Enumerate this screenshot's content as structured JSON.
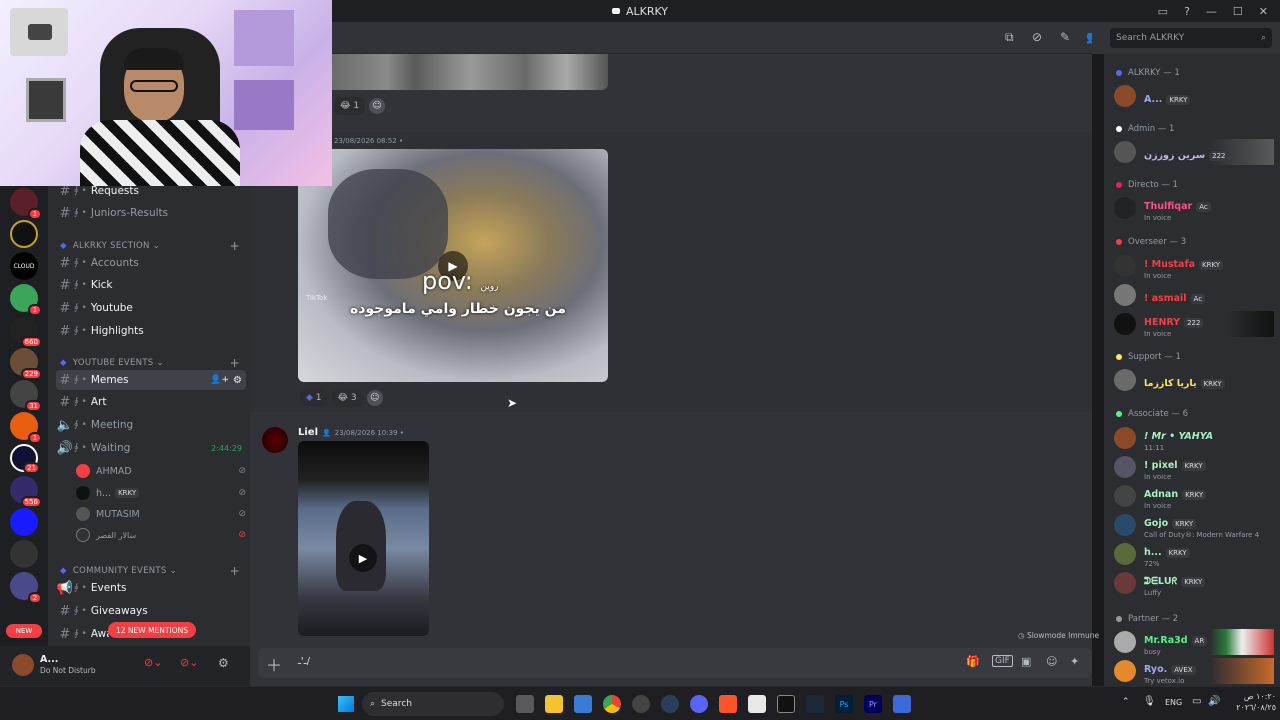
{
  "window": {
    "title": "ALKRKY"
  },
  "header": {
    "search_placeholder": "Search ALKRKY"
  },
  "channels": {
    "items_top": [
      {
        "label": "Requests"
      },
      {
        "label": "Juniors-Results"
      }
    ],
    "cat_alkrky": "ALKRKY SECTION",
    "alkrky_items": [
      {
        "label": "Accounts"
      },
      {
        "label": "Kick"
      },
      {
        "label": "Youtube"
      },
      {
        "label": "Highlights"
      }
    ],
    "cat_youtube": "YOUTUBE EVENTS",
    "youtube_items": [
      {
        "label": "Memes"
      },
      {
        "label": "Art"
      },
      {
        "label": "Meeting"
      },
      {
        "label": "Waiting",
        "timer": "2:44:29"
      }
    ],
    "voice_users": [
      {
        "name": "AHMAD"
      },
      {
        "name": "h...",
        "tag": "KRKY"
      },
      {
        "name": "MUTASIM"
      },
      {
        "name": "سالار الفصر"
      }
    ],
    "cat_community": "COMMUNITY EVENTS",
    "community_items": [
      {
        "label": "Events"
      },
      {
        "label": "Giveaways"
      },
      {
        "label": "Awards"
      }
    ],
    "mentions_banner": "12 NEW MENTIONS",
    "new_badge": "NEW"
  },
  "server_badges": [
    "1",
    "1",
    "660",
    "229",
    "31",
    "1",
    "21",
    "556",
    "2"
  ],
  "userbar": {
    "name": "A...",
    "status": "Do Not Disturb"
  },
  "messages": [
    {
      "time": "23/08/2026 08:52",
      "video_caption_1": "pov:",
      "video_caption_sub": "روين",
      "video_caption_2": "من يجون خطار وامي ماموجوده",
      "reactions": [
        {
          "count": "1"
        },
        {
          "count": "3"
        }
      ]
    },
    {
      "author": "Liel",
      "time": "23/08/2026 10:39"
    }
  ],
  "top_reaction": {
    "count": "1"
  },
  "composer": {
    "value": "ـ'ـ/",
    "slowmode": "Slowmode Immune"
  },
  "members": {
    "roles": [
      {
        "label": "ALKRKY — 1",
        "color": "#5865f2",
        "members": [
          {
            "name": "A...",
            "tag": "KRKY",
            "color": "#a3a6f0"
          }
        ]
      },
      {
        "label": "Admin — 1",
        "color": "#ffffff",
        "members": [
          {
            "name": "سرين زوززن",
            "tag": "222",
            "color": "#c4b5e8"
          }
        ]
      },
      {
        "label": "Directo — 1",
        "color": "#e91e63",
        "members": [
          {
            "name": "Thulfiqar",
            "tag": "Ac",
            "status": "In voice",
            "color": "#ff4d8d"
          }
        ]
      },
      {
        "label": "Overseer — 3",
        "color": "#f23f43",
        "members": [
          {
            "name": "! Mustafa",
            "tag": "KRKY",
            "status": "In voice",
            "color": "#f23f43"
          },
          {
            "name": "! asmail",
            "tag": "Ac",
            "color": "#f23f43"
          },
          {
            "name": "HENRY",
            "tag": "222",
            "status": "In voice",
            "color": "#f23f43"
          }
        ]
      },
      {
        "label": "Support — 1",
        "color": "#fee75c",
        "members": [
          {
            "name": "ياريا كاززما",
            "tag": "KRKY",
            "color": "#fee75c"
          }
        ]
      },
      {
        "label": "Associate — 6",
        "color": "#57f287",
        "members": [
          {
            "name": "! Mr • YAHYA",
            "status": "11:11",
            "color": "#a8f0c0"
          },
          {
            "name": "! pixel",
            "tag": "KRKY",
            "status": "In voice",
            "color": "#a8f0c0"
          },
          {
            "name": "Adnan",
            "tag": "KRKY",
            "status": "In voice",
            "color": "#a8f0c0"
          },
          {
            "name": "Gojo",
            "tag": "KRKY",
            "status": "Call of Duty®: Modern Warfare 4",
            "color": "#a8f0c0"
          },
          {
            "name": "h...",
            "tag": "KRKY",
            "status": "72%",
            "color": "#a8f0c0"
          },
          {
            "name": "ᕲᗴᒪᑌᖇ",
            "tag": "KRKY",
            "status": "Luffy",
            "color": "#a8f0c0"
          }
        ]
      },
      {
        "label": "Partner — 2",
        "color": "#949ba4",
        "members": [
          {
            "name": "Mr.Ra3d",
            "tag": "AR",
            "status": "busy",
            "color": "#57f287"
          },
          {
            "name": "Ryo.",
            "tag": "AVEX",
            "status": "Try vetox.io",
            "color": "#a3a6f0"
          }
        ]
      }
    ]
  },
  "taskbar": {
    "search_label": "Search",
    "lang": "ENG",
    "clock_time": "١٠:٢٠ ص",
    "clock_date": "٢٠٢٦/٠٨/٢٥"
  }
}
